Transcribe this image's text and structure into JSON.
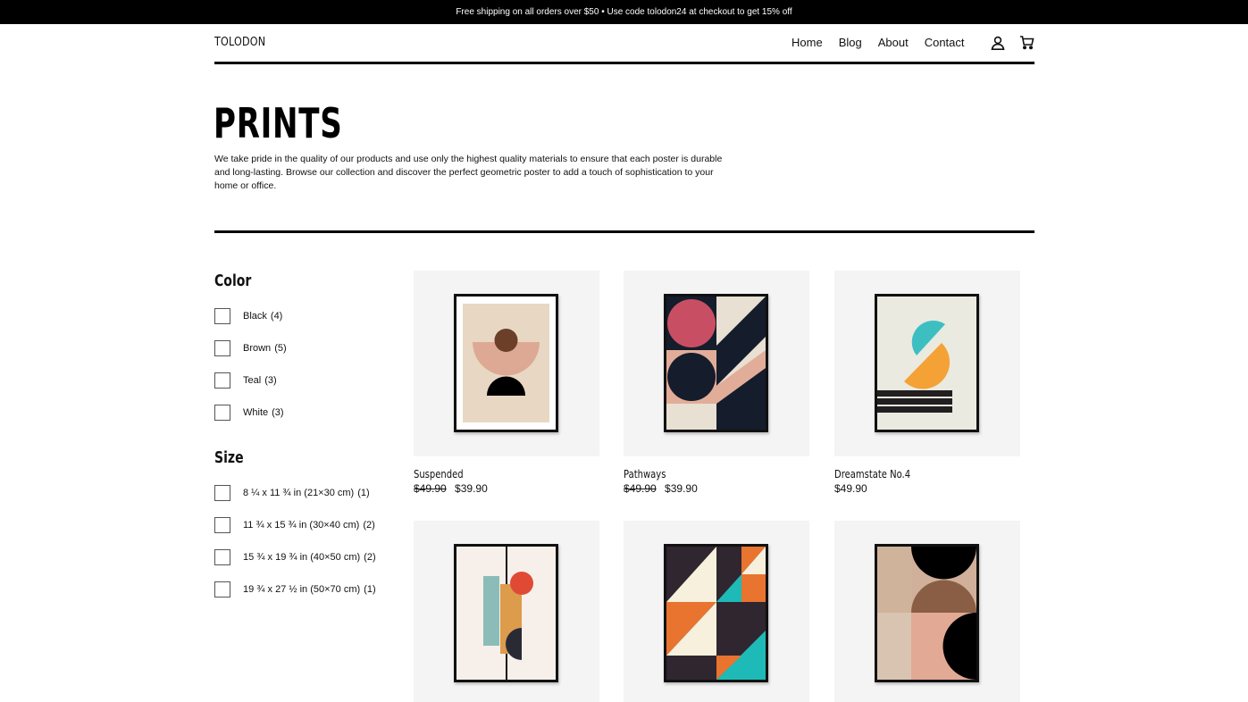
{
  "announcement": "Free shipping on all orders over $50  •  Use code tolodon24 at checkout to get 15% off",
  "header": {
    "brand": "TOLODON",
    "nav": [
      "Home",
      "Blog",
      "About",
      "Contact"
    ],
    "icons": [
      "user-icon",
      "cart-icon"
    ]
  },
  "hero": {
    "title": "PRINTS",
    "intro": "We take pride in the quality of our products and use only the highest quality materials to ensure that each poster is durable and long-lasting. Browse our collection and discover the perfect geometric poster to add a touch of sophistication to your home or office."
  },
  "filters": {
    "color": {
      "heading": "Color",
      "options": [
        {
          "label": "Black",
          "count": "(4)"
        },
        {
          "label": "Brown",
          "count": "(5)"
        },
        {
          "label": "Teal",
          "count": "(3)"
        },
        {
          "label": "White",
          "count": "(3)"
        }
      ]
    },
    "size": {
      "heading": "Size",
      "options": [
        {
          "label": "8 ¼ x 11 ¾ in (21×30 cm)",
          "count": "(1)"
        },
        {
          "label": "11 ¾ x 15 ¾ in (30×40 cm)",
          "count": "(2)"
        },
        {
          "label": "15 ¾ x 19 ¾ in (40×50 cm)",
          "count": "(2)"
        },
        {
          "label": "19 ¾ x 27 ½ in (50×70 cm)",
          "count": "(1)"
        }
      ]
    }
  },
  "products": [
    {
      "name": "Suspended",
      "old_price": "$49.90",
      "price": "$39.90"
    },
    {
      "name": "Pathways",
      "old_price": "$49.90",
      "price": "$39.90"
    },
    {
      "name": "Dreamstate No.4",
      "old_price": "",
      "price": "$49.90"
    },
    {
      "name": "",
      "old_price": "",
      "price": ""
    },
    {
      "name": "",
      "old_price": "",
      "price": ""
    },
    {
      "name": "",
      "old_price": "",
      "price": ""
    }
  ],
  "colors": {
    "bar": "#000000",
    "card_bg": "#f4f4f4",
    "teal": "#3dbfc2",
    "orange": "#f4a236",
    "rose": "#c84f63",
    "navy": "#151c2c"
  }
}
